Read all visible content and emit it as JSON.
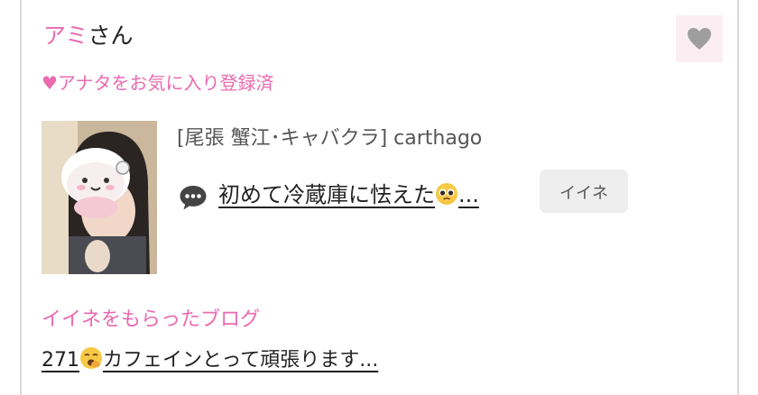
{
  "profile": {
    "name": "アミ",
    "name_suffix": "さん",
    "favorite_status": "♥アナタをお気に入り登録済"
  },
  "favorite_button": {
    "icon": "heart-icon",
    "color": "#9e9e9e",
    "background": "#fbeef3"
  },
  "post": {
    "shop": "[尾張 蟹江･キャバクラ]  carthago",
    "blog_title": "初めて冷蔵庫に怯えた",
    "blog_title_ellipsis": "...",
    "like_label": "イイネ"
  },
  "liked_blogs": {
    "title": "イイネをもらったブログ",
    "items": [
      {
        "count": "271",
        "text": "カフェインとって頑張ります..."
      }
    ]
  },
  "colors": {
    "accent_pink": "#ea6ab0",
    "border": "#d9d9d9"
  }
}
